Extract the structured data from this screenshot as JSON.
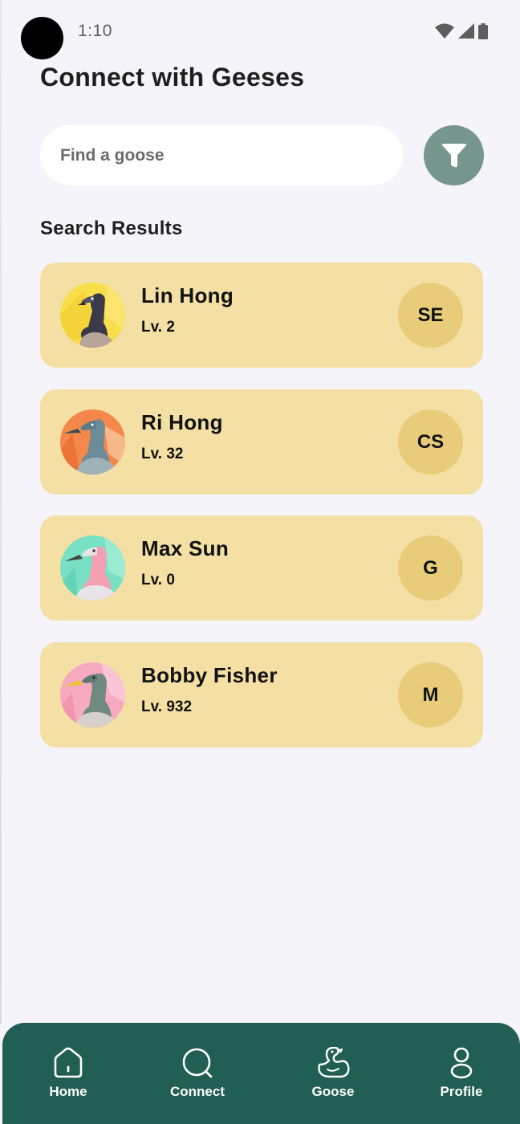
{
  "status_bar": {
    "time": "1:10"
  },
  "page": {
    "title": "Connect with Geeses"
  },
  "search": {
    "placeholder": "Find a goose"
  },
  "results": {
    "title": "Search Results",
    "items": [
      {
        "name": "Lin Hong",
        "level": "Lv. 2",
        "badge": "SE",
        "avatar_bg": "#f7de4a"
      },
      {
        "name": "Ri Hong",
        "level": "Lv. 32",
        "badge": "CS",
        "avatar_bg": "#f4874a"
      },
      {
        "name": "Max Sun",
        "level": "Lv. 0",
        "badge": "G",
        "avatar_bg": "#78e0c4"
      },
      {
        "name": "Bobby Fisher",
        "level": "Lv. 932",
        "badge": "M",
        "avatar_bg": "#f7a9c0"
      }
    ]
  },
  "nav": {
    "items": [
      {
        "label": "Home",
        "icon": "home-icon"
      },
      {
        "label": "Connect",
        "icon": "search-icon"
      },
      {
        "label": "Goose",
        "icon": "goose-icon"
      },
      {
        "label": "Profile",
        "icon": "profile-icon"
      }
    ]
  },
  "colors": {
    "background": "#f5f4fa",
    "card": "#f4e0a4",
    "badge": "#e8cc7a",
    "filter_button": "#77968d",
    "nav_bar": "#215e53"
  }
}
